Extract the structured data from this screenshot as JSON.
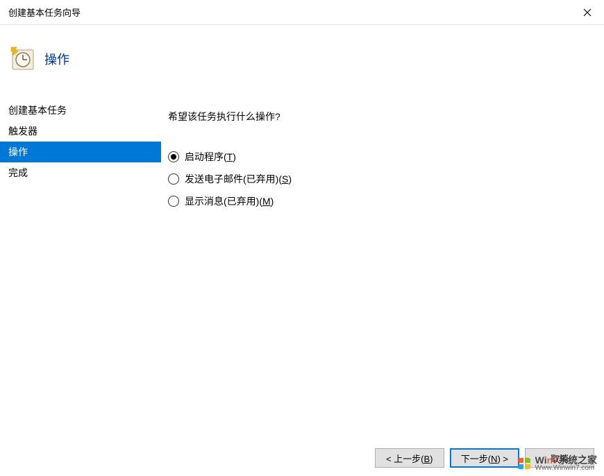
{
  "window": {
    "title": "创建基本任务向导"
  },
  "header": {
    "title": "操作"
  },
  "sidebar": {
    "items": [
      {
        "label": "创建基本任务"
      },
      {
        "label": "触发器"
      },
      {
        "label": "操作"
      },
      {
        "label": "完成"
      }
    ],
    "selected_index": 2
  },
  "main": {
    "prompt": "希望该任务执行什么操作?",
    "options": {
      "start_program": {
        "text": "启动程序(",
        "key": "T",
        "suffix": ")"
      },
      "send_email": {
        "text": "发送电子邮件(已弃用)(",
        "key": "S",
        "suffix": ")"
      },
      "display_message": {
        "text": "显示消息(已弃用)(",
        "key": "M",
        "suffix": ")"
      }
    },
    "selected_option": "start_program"
  },
  "footer": {
    "back": {
      "prefix": "< 上一步(",
      "key": "B",
      "suffix": ")"
    },
    "next": {
      "prefix": "下一步(",
      "key": "N",
      "suffix": ") >"
    },
    "cancel": "取消"
  },
  "watermark": {
    "line1_prefix": "Wi",
    "line1_highlight": "n7",
    "line1_suffix": "系统之家",
    "line2": "Www.Winwin7.com"
  }
}
